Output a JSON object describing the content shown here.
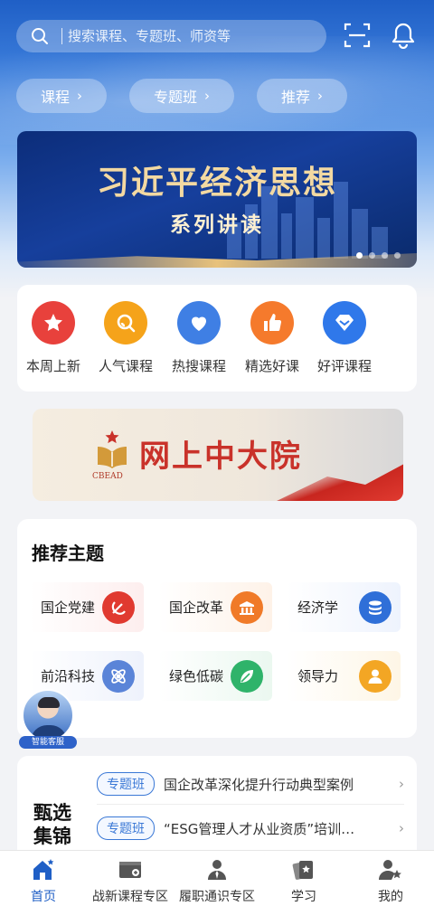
{
  "search": {
    "placeholder": "搜索课程、专题班、师资等"
  },
  "top_icons": {
    "scan": "scan-icon",
    "bell": "bell-icon"
  },
  "pills": [
    {
      "label": "课程"
    },
    {
      "label": "专题班"
    },
    {
      "label": "推荐"
    }
  ],
  "banner": {
    "title": "习近平经济思想",
    "subtitle": "系列讲读",
    "slides_total": 4,
    "active_slide": 1
  },
  "quick_links": [
    {
      "label": "本周上新",
      "icon": "star-icon",
      "color": "#e8413c"
    },
    {
      "label": "人气课程",
      "icon": "search-magnifier-icon",
      "color": "#f5a31a"
    },
    {
      "label": "热搜课程",
      "icon": "heart-icon",
      "color": "#3f7fe4"
    },
    {
      "label": "精选好课",
      "icon": "thumbs-up-icon",
      "color": "#f57a2c"
    },
    {
      "label": "好评课程",
      "icon": "diamond-icon",
      "color": "#2f78ea"
    }
  ],
  "promo": {
    "title": "网上中大院",
    "logo_text": "CBEAD"
  },
  "topics": {
    "heading": "推荐主题",
    "items": [
      {
        "label": "国企党建",
        "icon": "party-emblem-icon",
        "color": "#e03a30",
        "bg": "#fdeeee"
      },
      {
        "label": "国企改革",
        "icon": "building-icon",
        "color": "#f07a28",
        "bg": "#fef2e8"
      },
      {
        "label": "经济学",
        "icon": "coins-stack-icon",
        "color": "#2f6fd8",
        "bg": "#eef3fd"
      },
      {
        "label": "前沿科技",
        "icon": "atom-icon",
        "color": "#5a84d8",
        "bg": "#eef2fc"
      },
      {
        "label": "绿色低碳",
        "icon": "leaf-icon",
        "color": "#2fb36a",
        "bg": "#ebf8f0"
      },
      {
        "label": "领导力",
        "icon": "person-icon",
        "color": "#f3a624",
        "bg": "#fef6e6"
      }
    ]
  },
  "assistant": {
    "label": "智能客服"
  },
  "featured": {
    "side_title": "甄选集锦",
    "rows": [
      {
        "badge": "专题班",
        "text": "国企改革深化提升行动典型案例"
      },
      {
        "badge": "专题班",
        "text": "“ESG管理人才从业资质”培训…"
      }
    ]
  },
  "tabs": [
    {
      "label": "首页",
      "icon": "home-icon",
      "active": true
    },
    {
      "label": "战新课程专区",
      "icon": "video-plus-icon",
      "active": false
    },
    {
      "label": "履职通识专区",
      "icon": "person-tie-icon",
      "active": false
    },
    {
      "label": "学习",
      "icon": "cards-star-icon",
      "active": false
    },
    {
      "label": "我的",
      "icon": "user-star-icon",
      "active": false
    }
  ]
}
